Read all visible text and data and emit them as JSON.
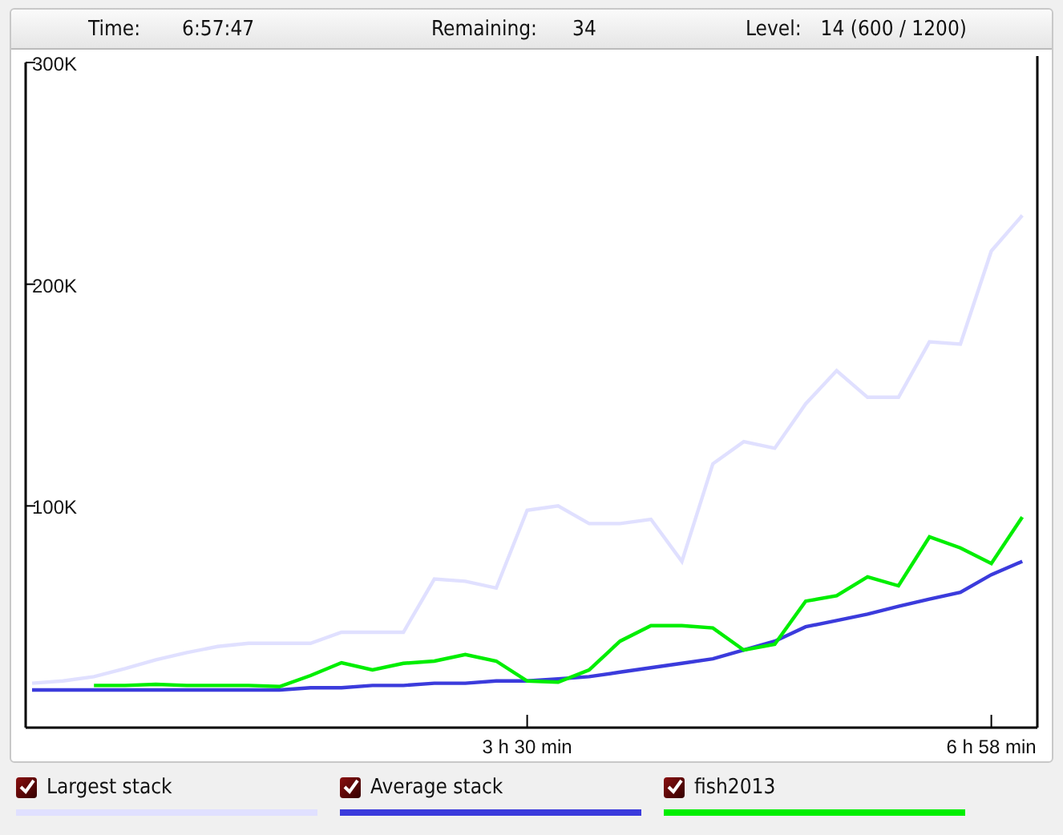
{
  "status_bar": {
    "items": [
      {
        "label": "Time:",
        "value": "6:57:47"
      },
      {
        "label": "Remaining:",
        "value": "34"
      },
      {
        "label": "Level:",
        "value": "14 (600 / 1200)"
      }
    ]
  },
  "chart": {
    "chart_data": {
      "type": "line",
      "categories": [
        null,
        null,
        null,
        null,
        null,
        null,
        null,
        null,
        null,
        null,
        null,
        null,
        null,
        null,
        null,
        null,
        "3 h 30 min",
        null,
        null,
        null,
        null,
        null,
        null,
        null,
        null,
        null,
        null,
        null,
        null,
        null,
        null,
        "6 h 58 min",
        null
      ],
      "ylim": [
        0,
        300000
      ],
      "yticks": [
        {
          "value": 100000,
          "label": "100K"
        },
        {
          "value": 200000,
          "label": "200K"
        },
        {
          "value": 300000,
          "label": "300K"
        }
      ],
      "series": [
        {
          "name": "Largest stack",
          "color": "#e0e0ff",
          "values": [
            20000,
            21000,
            23000,
            26600,
            30600,
            33800,
            36600,
            38000,
            38000,
            38000,
            43000,
            43000,
            43000,
            67000,
            66000,
            63000,
            98000,
            100000,
            92000,
            92000,
            94000,
            75000,
            119000,
            129000,
            126000,
            146000,
            161000,
            149000,
            149000,
            174000,
            173000,
            215000,
            231000
          ]
        },
        {
          "name": "Average stack",
          "color": "#3b3bdc",
          "values": [
            17000,
            17000,
            17000,
            17000,
            17000,
            17000,
            17000,
            17000,
            17000,
            18000,
            18000,
            19000,
            19000,
            20000,
            20000,
            21000,
            21000,
            22000,
            23000,
            25000,
            27000,
            29000,
            31000,
            35000,
            39000,
            45500,
            48300,
            51200,
            54700,
            58000,
            61000,
            69000,
            75000
          ]
        },
        {
          "name": "fish2013",
          "color": "#00ee00",
          "values": [
            null,
            null,
            19000,
            19000,
            19500,
            19000,
            19000,
            19000,
            18500,
            23500,
            29300,
            26000,
            29000,
            30000,
            33000,
            30000,
            21000,
            20500,
            26000,
            39000,
            46000,
            46000,
            45000,
            35000,
            37600,
            57000,
            59500,
            68000,
            64000,
            86000,
            81000,
            74000,
            95000
          ]
        }
      ]
    },
    "legend": [
      {
        "checked": true
      },
      {
        "checked": true
      },
      {
        "checked": true
      }
    ]
  }
}
